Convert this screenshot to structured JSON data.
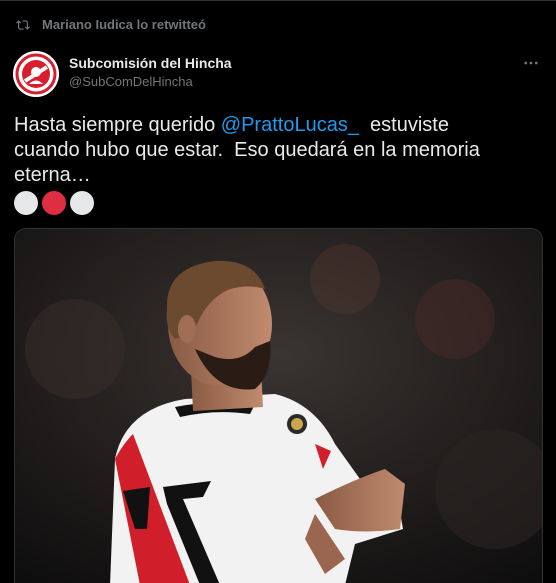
{
  "retweet": {
    "text": "Mariano Iudica lo retwitteó",
    "icon": "retweet-icon"
  },
  "author": {
    "display_name": "Subcomisión del Hincha",
    "handle": "@SubComDelHincha",
    "avatar_icon": "club-crest-avatar"
  },
  "more": {
    "icon": "more-options-icon"
  },
  "tweet": {
    "text_before": "Hasta siempre querido ",
    "mention": "@PrattoLucas_",
    "text_after": "  estuviste\ncuando hubo que estar.  Eso quedará en la memoria\neterna…",
    "emojis": [
      "white-circle",
      "red-circle",
      "white-circle"
    ]
  },
  "media": {
    "kind": "photo"
  },
  "colors": {
    "background": "#000000",
    "text": "#e7e9ea",
    "secondary": "#71767b",
    "link": "#1d9bf0",
    "red": "#e0245e"
  }
}
